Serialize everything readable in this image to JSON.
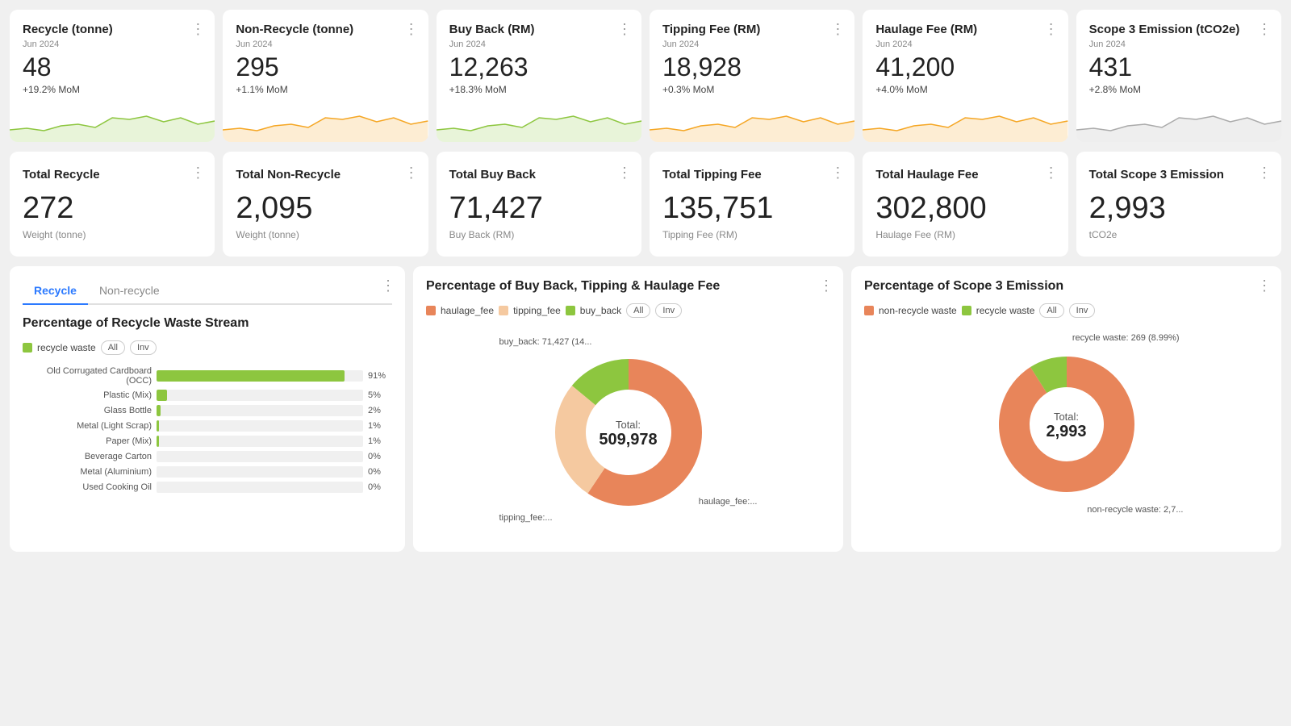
{
  "row1": {
    "cards": [
      {
        "title": "Recycle (tonne)",
        "date": "Jun 2024",
        "value": "48",
        "change": "+19.2% MoM",
        "sparkColor": "#8dc63f",
        "sparkFill": "rgba(141,198,63,0.2)"
      },
      {
        "title": "Non-Recycle (tonne)",
        "date": "Jun 2024",
        "value": "295",
        "change": "+1.1% MoM",
        "sparkColor": "#f5a623",
        "sparkFill": "rgba(245,166,35,0.2)"
      },
      {
        "title": "Buy Back (RM)",
        "date": "Jun 2024",
        "value": "12,263",
        "change": "+18.3% MoM",
        "sparkColor": "#8dc63f",
        "sparkFill": "rgba(141,198,63,0.2)"
      },
      {
        "title": "Tipping Fee (RM)",
        "date": "Jun 2024",
        "value": "18,928",
        "change": "+0.3% MoM",
        "sparkColor": "#f5a623",
        "sparkFill": "rgba(245,166,35,0.2)"
      },
      {
        "title": "Haulage Fee (RM)",
        "date": "Jun 2024",
        "value": "41,200",
        "change": "+4.0% MoM",
        "sparkColor": "#f5a623",
        "sparkFill": "rgba(245,166,35,0.2)"
      },
      {
        "title": "Scope 3 Emission (tCO2e)",
        "date": "Jun 2024",
        "value": "431",
        "change": "+2.8% MoM",
        "sparkColor": "#aaaaaa",
        "sparkFill": "rgba(170,170,170,0.2)"
      }
    ]
  },
  "row2": {
    "cards": [
      {
        "title": "Total Recycle",
        "value": "272",
        "sub": "Weight (tonne)"
      },
      {
        "title": "Total Non-Recycle",
        "value": "2,095",
        "sub": "Weight (tonne)"
      },
      {
        "title": "Total Buy Back",
        "value": "71,427",
        "sub": "Buy Back (RM)"
      },
      {
        "title": "Total Tipping Fee",
        "value": "135,751",
        "sub": "Tipping Fee (RM)"
      },
      {
        "title": "Total Haulage Fee",
        "value": "302,800",
        "sub": "Haulage Fee (RM)"
      },
      {
        "title": "Total Scope 3 Emission",
        "value": "2,993",
        "sub": "tCO2e"
      }
    ]
  },
  "tabs": [
    "Recycle",
    "Non-recycle"
  ],
  "activeTab": 0,
  "barChart": {
    "title": "Percentage of Recycle Waste Stream",
    "legend": "recycle waste",
    "legendColor": "#8dc63f",
    "allLabel": "All",
    "invLabel": "Inv",
    "bars": [
      {
        "label": "Old Corrugated Cardboard (OCC)",
        "pct": 91,
        "display": "91%"
      },
      {
        "label": "Plastic (Mix)",
        "pct": 5,
        "display": "5%"
      },
      {
        "label": "Glass Bottle",
        "pct": 2,
        "display": "2%"
      },
      {
        "label": "Metal (Light Scrap)",
        "pct": 1,
        "display": "1%"
      },
      {
        "label": "Paper (Mix)",
        "pct": 1,
        "display": "1%"
      },
      {
        "label": "Beverage Carton",
        "pct": 0,
        "display": "0%"
      },
      {
        "label": "Metal (Aluminium)",
        "pct": 0,
        "display": "0%"
      },
      {
        "label": "Used Cooking Oil",
        "pct": 0,
        "display": "0%"
      }
    ]
  },
  "donut1": {
    "title": "Percentage of Buy Back, Tipping & Haulage Fee",
    "totalLabel": "Total:",
    "totalValue": "509,978",
    "legends": [
      {
        "label": "haulage_fee",
        "color": "#e8855a"
      },
      {
        "label": "tipping_fee",
        "color": "#f5c9a0"
      },
      {
        "label": "buy_back",
        "color": "#8dc63f"
      }
    ],
    "segments": [
      {
        "label": "haulage_fee",
        "value": 302800,
        "color": "#e8855a",
        "pct": 59.4
      },
      {
        "label": "tipping_fee",
        "value": 135751,
        "color": "#f5c9a0",
        "pct": 26.6
      },
      {
        "label": "buy_back",
        "value": 71427,
        "color": "#8dc63f",
        "pct": 14.0
      }
    ],
    "tooltips": {
      "buyBack": "buy_back: 71,427 (14...",
      "tipping": "tipping_fee:...",
      "haulage": "haulage_fee:..."
    }
  },
  "donut2": {
    "title": "Percentage of Scope 3 Emission",
    "totalLabel": "Total:",
    "totalValue": "2,993",
    "legends": [
      {
        "label": "non-recycle waste",
        "color": "#e8855a"
      },
      {
        "label": "recycle waste",
        "color": "#8dc63f"
      }
    ],
    "segments": [
      {
        "label": "non-recycle waste",
        "value": 2724,
        "color": "#e8855a",
        "pct": 91.01
      },
      {
        "label": "recycle waste",
        "value": 269,
        "color": "#8dc63f",
        "pct": 8.99
      }
    ],
    "tooltips": {
      "recycle": "recycle waste: 269 (8.99%)",
      "nonRecycle": "non-recycle waste: 2,7..."
    }
  },
  "menuIcon": "⋮"
}
